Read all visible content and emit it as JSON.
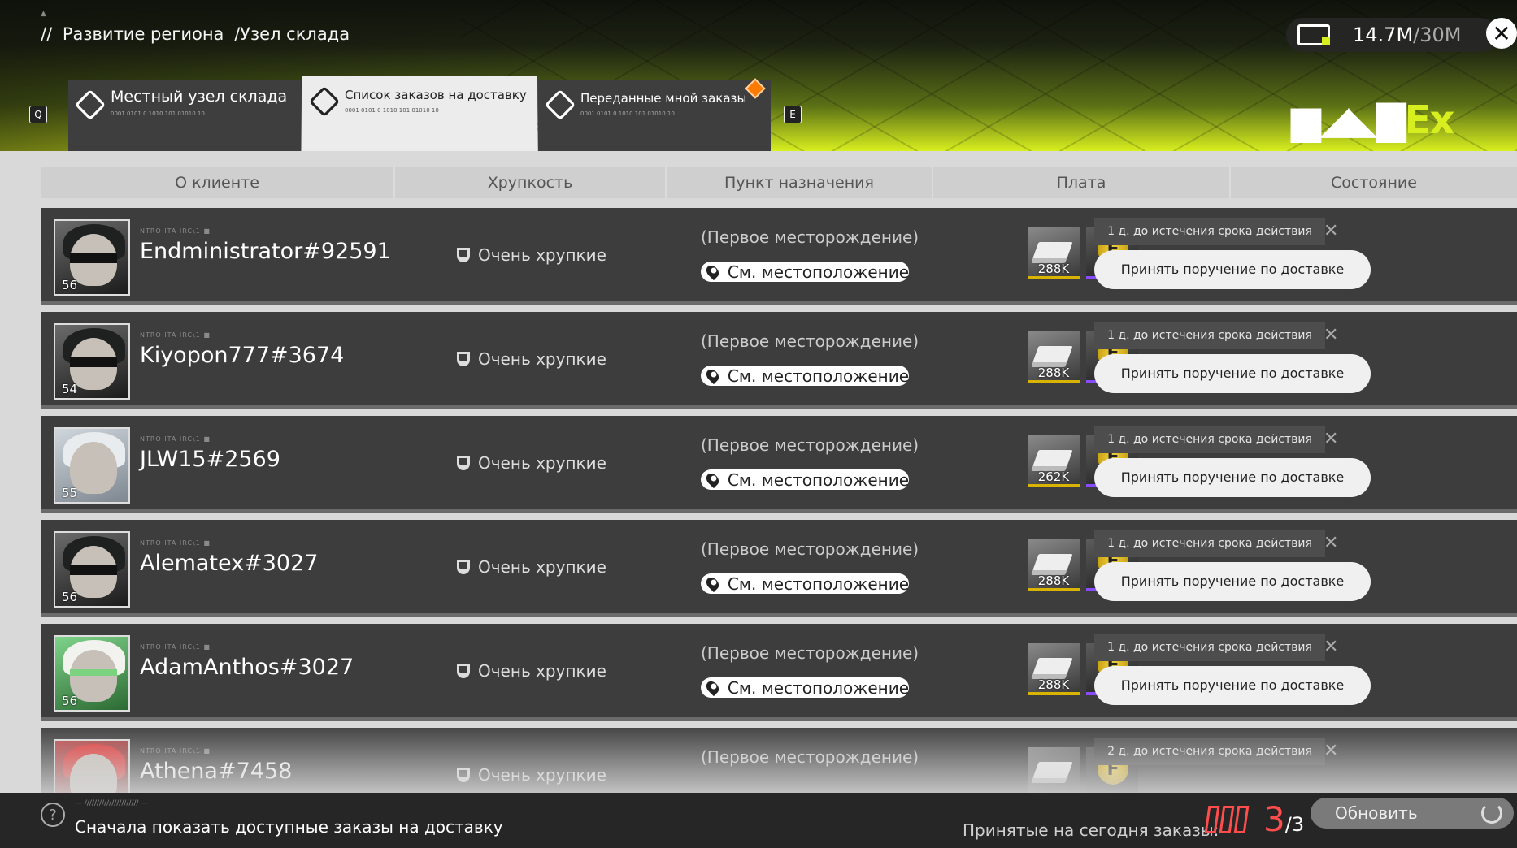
{
  "header": {
    "breadcrumb": [
      "//",
      "Развитие региона",
      "/Узел склада"
    ],
    "currency": {
      "value": "14.7M",
      "max": "/30M",
      "icon": "storage-icon"
    },
    "tabs": [
      {
        "label": "Местный узел склада",
        "code": "0001 0101 0 1010 101 01010 10",
        "icon": "local-warehouse-icon",
        "hotkey": "Q"
      },
      {
        "label": "Список заказов на доставку",
        "code": "0001 0101 0 1010 101 01010 10",
        "icon": "delivery-list-icon",
        "active": true
      },
      {
        "label": "Переданные мной заказы",
        "code": "0001 0101 0 1010 101 01010 10",
        "icon": "my-orders-icon",
        "hotkey": "E"
      }
    ],
    "brand": {
      "part1": "▆◢◣▇",
      "part2": "Ex"
    },
    "accent": "#d8ef1f",
    "badge_color": "#ff7a00"
  },
  "table": {
    "columns": [
      "О клиенте",
      "Хрупкость",
      "Пункт назначения",
      "Плата",
      "Состояние"
    ],
    "rows": [
      {
        "name": "Endministrator#92591",
        "level": "56",
        "fragility": "Очень хрупкие",
        "destination": "(Первое месторождение)",
        "location_button": "См. местоположение",
        "reward1": "288K",
        "reward2": "30",
        "expire": "1 д. до истечения срока действия",
        "accept": "Принять поручение по доставке",
        "avatar": "dark"
      },
      {
        "name": "Kiyopon777#3674",
        "level": "54",
        "fragility": "Очень хрупкие",
        "destination": "(Первое месторождение)",
        "location_button": "См. местоположение",
        "reward1": "288K",
        "reward2": "30",
        "expire": "1 д. до истечения срока действия",
        "accept": "Принять поручение по доставке",
        "avatar": "dark"
      },
      {
        "name": "JLW15#2569",
        "level": "55",
        "fragility": "Очень хрупкие",
        "destination": "(Первое месторождение)",
        "location_button": "См. местоположение",
        "reward1": "262K",
        "reward2": "30",
        "expire": "1 д. до истечения срока действия",
        "accept": "Принять поручение по доставке",
        "avatar": "light"
      },
      {
        "name": "Alematex#3027",
        "level": "56",
        "fragility": "Очень хрупкие",
        "destination": "(Первое месторождение)",
        "location_button": "См. местоположение",
        "reward1": "288K",
        "reward2": "30",
        "expire": "1 д. до истечения срока действия",
        "accept": "Принять поручение по доставке",
        "avatar": "dark"
      },
      {
        "name": "AdamAnthos#3027",
        "level": "56",
        "fragility": "Очень хрупкие",
        "destination": "(Первое месторождение)",
        "location_button": "См. местоположение",
        "reward1": "288K",
        "reward2": "30",
        "expire": "1 д. до истечения срока действия",
        "accept": "Принять поручение по доставке",
        "avatar": "green"
      },
      {
        "name": "Athena#7458",
        "level": "",
        "fragility": "Очень хрупкие",
        "destination": "(Первое месторождение)",
        "location_button": "",
        "reward1": "",
        "reward2": "",
        "expire": "2 д. до истечения срока действия",
        "accept": "",
        "avatar": "red"
      }
    ],
    "codeline": "NTRO ITA IRC\\1 ■"
  },
  "footer": {
    "small_text": "— ////////////////////// —",
    "filter_label": "Сначала показать доступные заказы на доставку",
    "accepted_label": "Принятые на сегодня заказы:",
    "accepted_count": "3",
    "accepted_total": "/3",
    "refresh_label": "Обновить",
    "counter_color": "#ff4d4d"
  }
}
